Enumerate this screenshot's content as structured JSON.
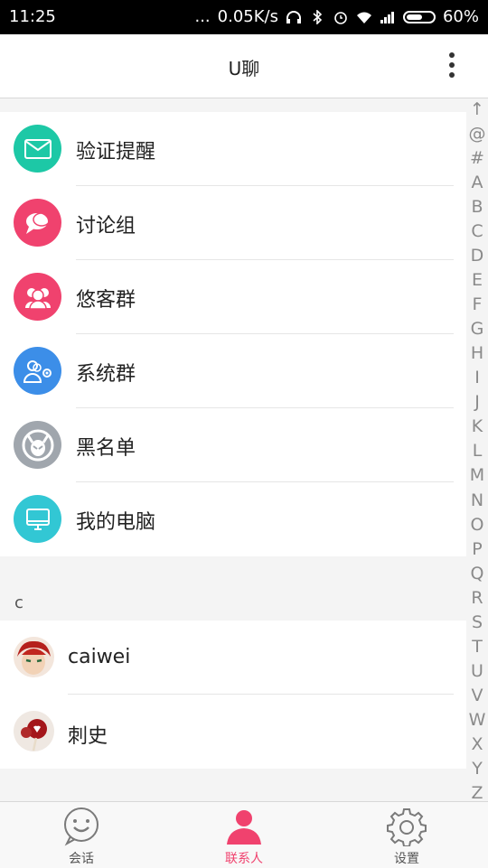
{
  "status_bar": {
    "time": "11:25",
    "dots": "...",
    "net_speed": "0.05K/s",
    "battery_pct_text": "60%",
    "battery_level": 0.6
  },
  "header": {
    "title": "U聊",
    "menu_icon": "more-vert-icon"
  },
  "groups": [
    {
      "label": "验证提醒",
      "icon": "envelope-icon",
      "color": "#1dc8a6"
    },
    {
      "label": "讨论组",
      "icon": "chat-bubbles-icon",
      "color": "#f0426e"
    },
    {
      "label": "悠客群",
      "icon": "people-group-icon",
      "color": "#f0426e"
    },
    {
      "label": "系统群",
      "icon": "people-gear-icon",
      "color": "#3c8ee8"
    },
    {
      "label": "黑名单",
      "icon": "devil-icon",
      "color": "#a0a6ad"
    },
    {
      "label": "我的电脑",
      "icon": "monitor-icon",
      "color": "#32c7d4"
    }
  ],
  "section": {
    "letter": "c"
  },
  "contacts": [
    {
      "name": "caiwei"
    },
    {
      "name": "刺史"
    }
  ],
  "index_bar": [
    "↑",
    "@",
    "#",
    "A",
    "B",
    "C",
    "D",
    "E",
    "F",
    "G",
    "H",
    "I",
    "J",
    "K",
    "L",
    "M",
    "N",
    "O",
    "P",
    "Q",
    "R",
    "S",
    "T",
    "U",
    "V",
    "W",
    "X",
    "Y",
    "Z"
  ],
  "tabs": [
    {
      "label": "会话",
      "icon": "smile-chat-icon",
      "active": false
    },
    {
      "label": "联系人",
      "icon": "person-icon",
      "active": true
    },
    {
      "label": "设置",
      "icon": "gear-icon",
      "active": false
    }
  ],
  "colors": {
    "accent": "#f0426e",
    "inactive": "#555555"
  }
}
